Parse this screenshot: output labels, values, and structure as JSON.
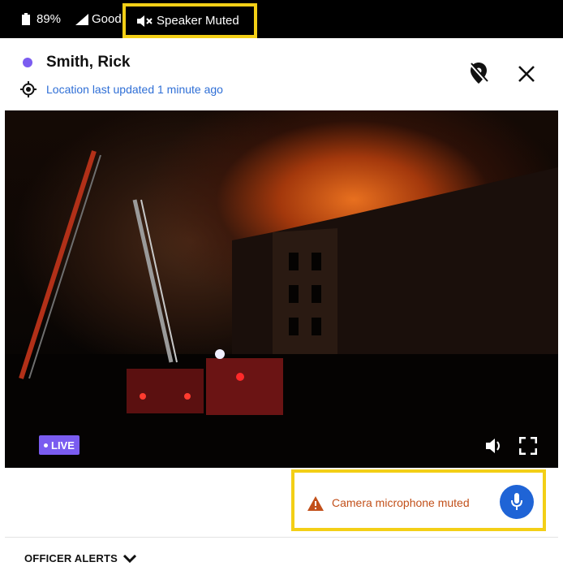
{
  "status_bar": {
    "battery": "89%",
    "signal": "Good",
    "speaker": "Speaker Muted"
  },
  "header": {
    "officer_name": "Smith, Rick",
    "location_status": "Location last updated 1 minute ago",
    "status_color": "#7b5cf0"
  },
  "video": {
    "live_label": "LIVE"
  },
  "microphone": {
    "warning": "Camera microphone muted",
    "accent_color": "#1f64d6"
  },
  "alerts": {
    "label": "OFFICER ALERTS"
  },
  "icons": [
    "battery-icon",
    "signal-icon",
    "speaker-muted-icon",
    "target-icon",
    "location-off-icon",
    "close-icon",
    "volume-icon",
    "fullscreen-icon",
    "warning-icon",
    "microphone-icon",
    "chevron-down-icon"
  ],
  "highlight_color": "#f3cf16"
}
